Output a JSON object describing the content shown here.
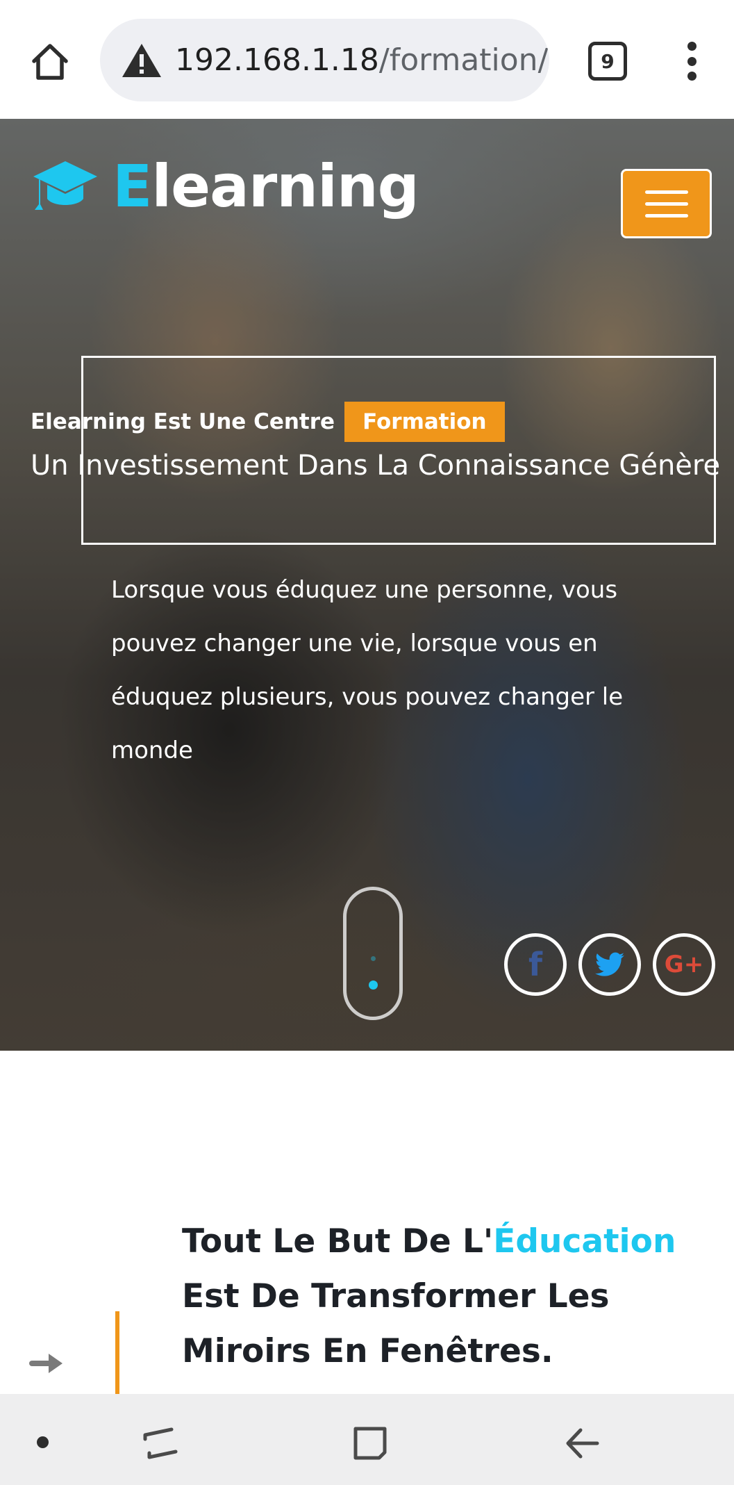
{
  "browser": {
    "url_host": "192.168.1.18",
    "url_path": "/formation/",
    "tab_count": "9",
    "icons": {
      "home": "home-icon",
      "warning": "warning-icon",
      "tabs": "tabs-icon",
      "menu": "more-vert-icon"
    }
  },
  "hero": {
    "logo_first": "E",
    "logo_rest": "learning",
    "menu_icon": "hamburger-icon",
    "headline_prefix": "Elearning Est Une Centre",
    "headline_badge": "Formation",
    "headline_sub": "Un Investissement Dans La Connaissance Génère",
    "lead": "Lorsque vous éduquez une personne, vous pouvez changer une vie, lorsque vous en éduquez plusieurs, vous pouvez changer le monde",
    "social": {
      "facebook": "f",
      "google_plus": "G+"
    }
  },
  "content": {
    "quote_start": "Tout Le But De L'",
    "quote_accent": "Éducation",
    "quote_end": " Est De Transformer Les Miroirs En Fenêtres."
  },
  "colors": {
    "accent_cyan": "#1ec7ef",
    "accent_orange": "#f0961a",
    "text_dark": "#1d2127"
  }
}
